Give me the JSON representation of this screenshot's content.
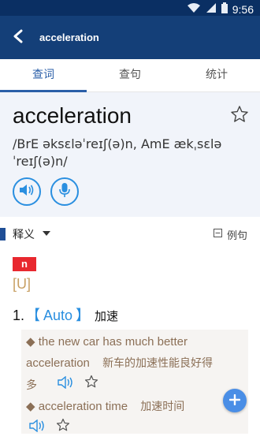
{
  "status": {
    "time": "9:56"
  },
  "appbar": {
    "title": "acceleration"
  },
  "tabs": [
    {
      "label": "查词"
    },
    {
      "label": "查句"
    },
    {
      "label": "统计"
    }
  ],
  "entry": {
    "word": "acceleration",
    "phonetic": "/BrE əksɛləˈreɪʃ(ə)n, AmE ækˌsɛləˈreɪʃ(ə)n/"
  },
  "section": {
    "title": "释义",
    "examples_label": "例句"
  },
  "definition": {
    "pos": "n",
    "grammar": "[U]",
    "number": "1.",
    "domain_open": "【",
    "domain": "Auto",
    "domain_close": "】",
    "meaning": "加速"
  },
  "examples": [
    {
      "en": "◆ the new car has much better",
      "en2": "acceleration",
      "zh": "新车的加速性能良好得",
      "zh2": "多"
    },
    {
      "en": "◆ acceleration time",
      "zh": "加速时间"
    }
  ],
  "colors": {
    "header": "#143f78",
    "accent": "#2a8fe0",
    "pos_bg": "#e8282f",
    "example_text": "#8b6f56"
  },
  "icons": [
    "back-arrow-icon",
    "wifi-icon",
    "signal-icon",
    "battery-icon",
    "star-icon",
    "speaker-icon",
    "microphone-icon",
    "caret-down-icon",
    "square-minus-icon",
    "plus-icon"
  ]
}
